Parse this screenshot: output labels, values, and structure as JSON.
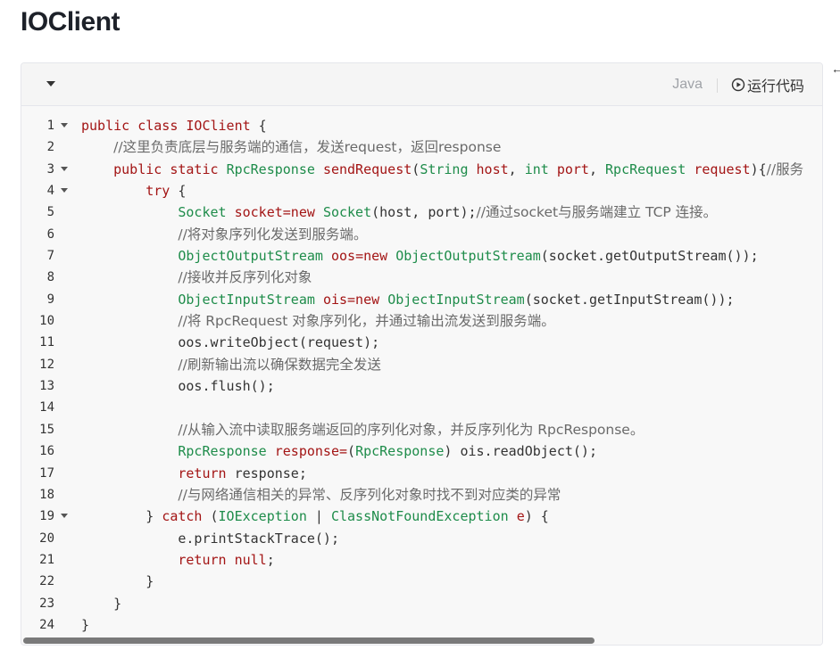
{
  "page": {
    "title": "IOClient",
    "side_arrow": "←"
  },
  "toolbar": {
    "language": "Java",
    "run_label": "运行代码"
  },
  "colors": {
    "keyword": "#a31515",
    "type": "#1e8c4a",
    "comment": "#6a6a6a",
    "plain": "#333333"
  },
  "icons": {
    "collapse": "chevron-down-icon",
    "run": "play-circle-icon",
    "fold": "fold-arrow-icon"
  },
  "code_lines": [
    {
      "n": "1",
      "fold": true,
      "tokens": [
        [
          "kw",
          "public class "
        ],
        [
          "var",
          "IOClient"
        ],
        [
          "plain",
          " {"
        ]
      ]
    },
    {
      "n": "2",
      "fold": false,
      "tokens": [
        [
          "plain",
          "    "
        ],
        [
          "cmt",
          "//这里负责底层与服务端的通信，发送request，返回response"
        ]
      ]
    },
    {
      "n": "3",
      "fold": true,
      "tokens": [
        [
          "plain",
          "    "
        ],
        [
          "kw",
          "public static "
        ],
        [
          "type",
          "RpcResponse "
        ],
        [
          "var",
          "sendRequest"
        ],
        [
          "plain",
          "("
        ],
        [
          "type",
          "String "
        ],
        [
          "var",
          "host"
        ],
        [
          "plain",
          ", "
        ],
        [
          "type",
          "int "
        ],
        [
          "var",
          "port"
        ],
        [
          "plain",
          ", "
        ],
        [
          "type",
          "RpcRequest "
        ],
        [
          "var",
          "request"
        ],
        [
          "plain",
          "){"
        ],
        [
          "cmt",
          "//服务"
        ]
      ]
    },
    {
      "n": "4",
      "fold": true,
      "tokens": [
        [
          "plain",
          "        "
        ],
        [
          "kw",
          "try"
        ],
        [
          "plain",
          " {"
        ]
      ]
    },
    {
      "n": "5",
      "fold": false,
      "tokens": [
        [
          "plain",
          "            "
        ],
        [
          "type",
          "Socket "
        ],
        [
          "var",
          "socket"
        ],
        [
          "kw",
          "=new "
        ],
        [
          "type",
          "Socket"
        ],
        [
          "plain",
          "(host, port);"
        ],
        [
          "cmt",
          "//通过socket与服务端建立 TCP 连接。"
        ]
      ]
    },
    {
      "n": "6",
      "fold": false,
      "tokens": [
        [
          "plain",
          "            "
        ],
        [
          "cmt",
          "//将对象序列化发送到服务端。"
        ]
      ]
    },
    {
      "n": "7",
      "fold": false,
      "tokens": [
        [
          "plain",
          "            "
        ],
        [
          "type",
          "ObjectOutputStream "
        ],
        [
          "var",
          "oos"
        ],
        [
          "kw",
          "=new "
        ],
        [
          "type",
          "ObjectOutputStream"
        ],
        [
          "plain",
          "(socket.getOutputStream());"
        ]
      ]
    },
    {
      "n": "8",
      "fold": false,
      "tokens": [
        [
          "plain",
          "            "
        ],
        [
          "cmt",
          "//接收并反序列化对象"
        ]
      ]
    },
    {
      "n": "9",
      "fold": false,
      "tokens": [
        [
          "plain",
          "            "
        ],
        [
          "type",
          "ObjectInputStream "
        ],
        [
          "var",
          "ois"
        ],
        [
          "kw",
          "=new "
        ],
        [
          "type",
          "ObjectInputStream"
        ],
        [
          "plain",
          "(socket.getInputStream());"
        ]
      ]
    },
    {
      "n": "10",
      "fold": false,
      "tokens": [
        [
          "plain",
          "            "
        ],
        [
          "cmt",
          "//将 RpcRequest 对象序列化，并通过输出流发送到服务端。"
        ]
      ]
    },
    {
      "n": "11",
      "fold": false,
      "tokens": [
        [
          "plain",
          "            oos.writeObject(request);"
        ]
      ]
    },
    {
      "n": "12",
      "fold": false,
      "tokens": [
        [
          "plain",
          "            "
        ],
        [
          "cmt",
          "//刷新输出流以确保数据完全发送"
        ]
      ]
    },
    {
      "n": "13",
      "fold": false,
      "tokens": [
        [
          "plain",
          "            oos.flush();"
        ]
      ]
    },
    {
      "n": "14",
      "fold": false,
      "tokens": []
    },
    {
      "n": "15",
      "fold": false,
      "tokens": [
        [
          "plain",
          "            "
        ],
        [
          "cmt",
          "//从输入流中读取服务端返回的序列化对象，并反序列化为 RpcResponse。"
        ]
      ]
    },
    {
      "n": "16",
      "fold": false,
      "tokens": [
        [
          "plain",
          "            "
        ],
        [
          "type",
          "RpcResponse "
        ],
        [
          "var",
          "response"
        ],
        [
          "kw",
          "="
        ],
        [
          "plain",
          "("
        ],
        [
          "type",
          "RpcResponse"
        ],
        [
          "plain",
          ") ois.readObject();"
        ]
      ]
    },
    {
      "n": "17",
      "fold": false,
      "tokens": [
        [
          "plain",
          "            "
        ],
        [
          "kw",
          "return "
        ],
        [
          "plain",
          "response;"
        ]
      ]
    },
    {
      "n": "18",
      "fold": false,
      "tokens": [
        [
          "plain",
          "            "
        ],
        [
          "cmt",
          "//与网络通信相关的异常、反序列化对象时找不到对应类的异常"
        ]
      ]
    },
    {
      "n": "19",
      "fold": true,
      "tokens": [
        [
          "plain",
          "        } "
        ],
        [
          "kw",
          "catch "
        ],
        [
          "plain",
          "("
        ],
        [
          "type",
          "IOException "
        ],
        [
          "plain",
          "| "
        ],
        [
          "type",
          "ClassNotFoundException "
        ],
        [
          "var",
          "e"
        ],
        [
          "plain",
          ") {"
        ]
      ]
    },
    {
      "n": "20",
      "fold": false,
      "tokens": [
        [
          "plain",
          "            e.printStackTrace();"
        ]
      ]
    },
    {
      "n": "21",
      "fold": false,
      "tokens": [
        [
          "plain",
          "            "
        ],
        [
          "kw",
          "return null"
        ],
        [
          "plain",
          ";"
        ]
      ]
    },
    {
      "n": "22",
      "fold": false,
      "tokens": [
        [
          "plain",
          "        }"
        ]
      ]
    },
    {
      "n": "23",
      "fold": false,
      "tokens": [
        [
          "plain",
          "    }"
        ]
      ]
    },
    {
      "n": "24",
      "fold": false,
      "tokens": [
        [
          "plain",
          "}"
        ]
      ]
    }
  ]
}
